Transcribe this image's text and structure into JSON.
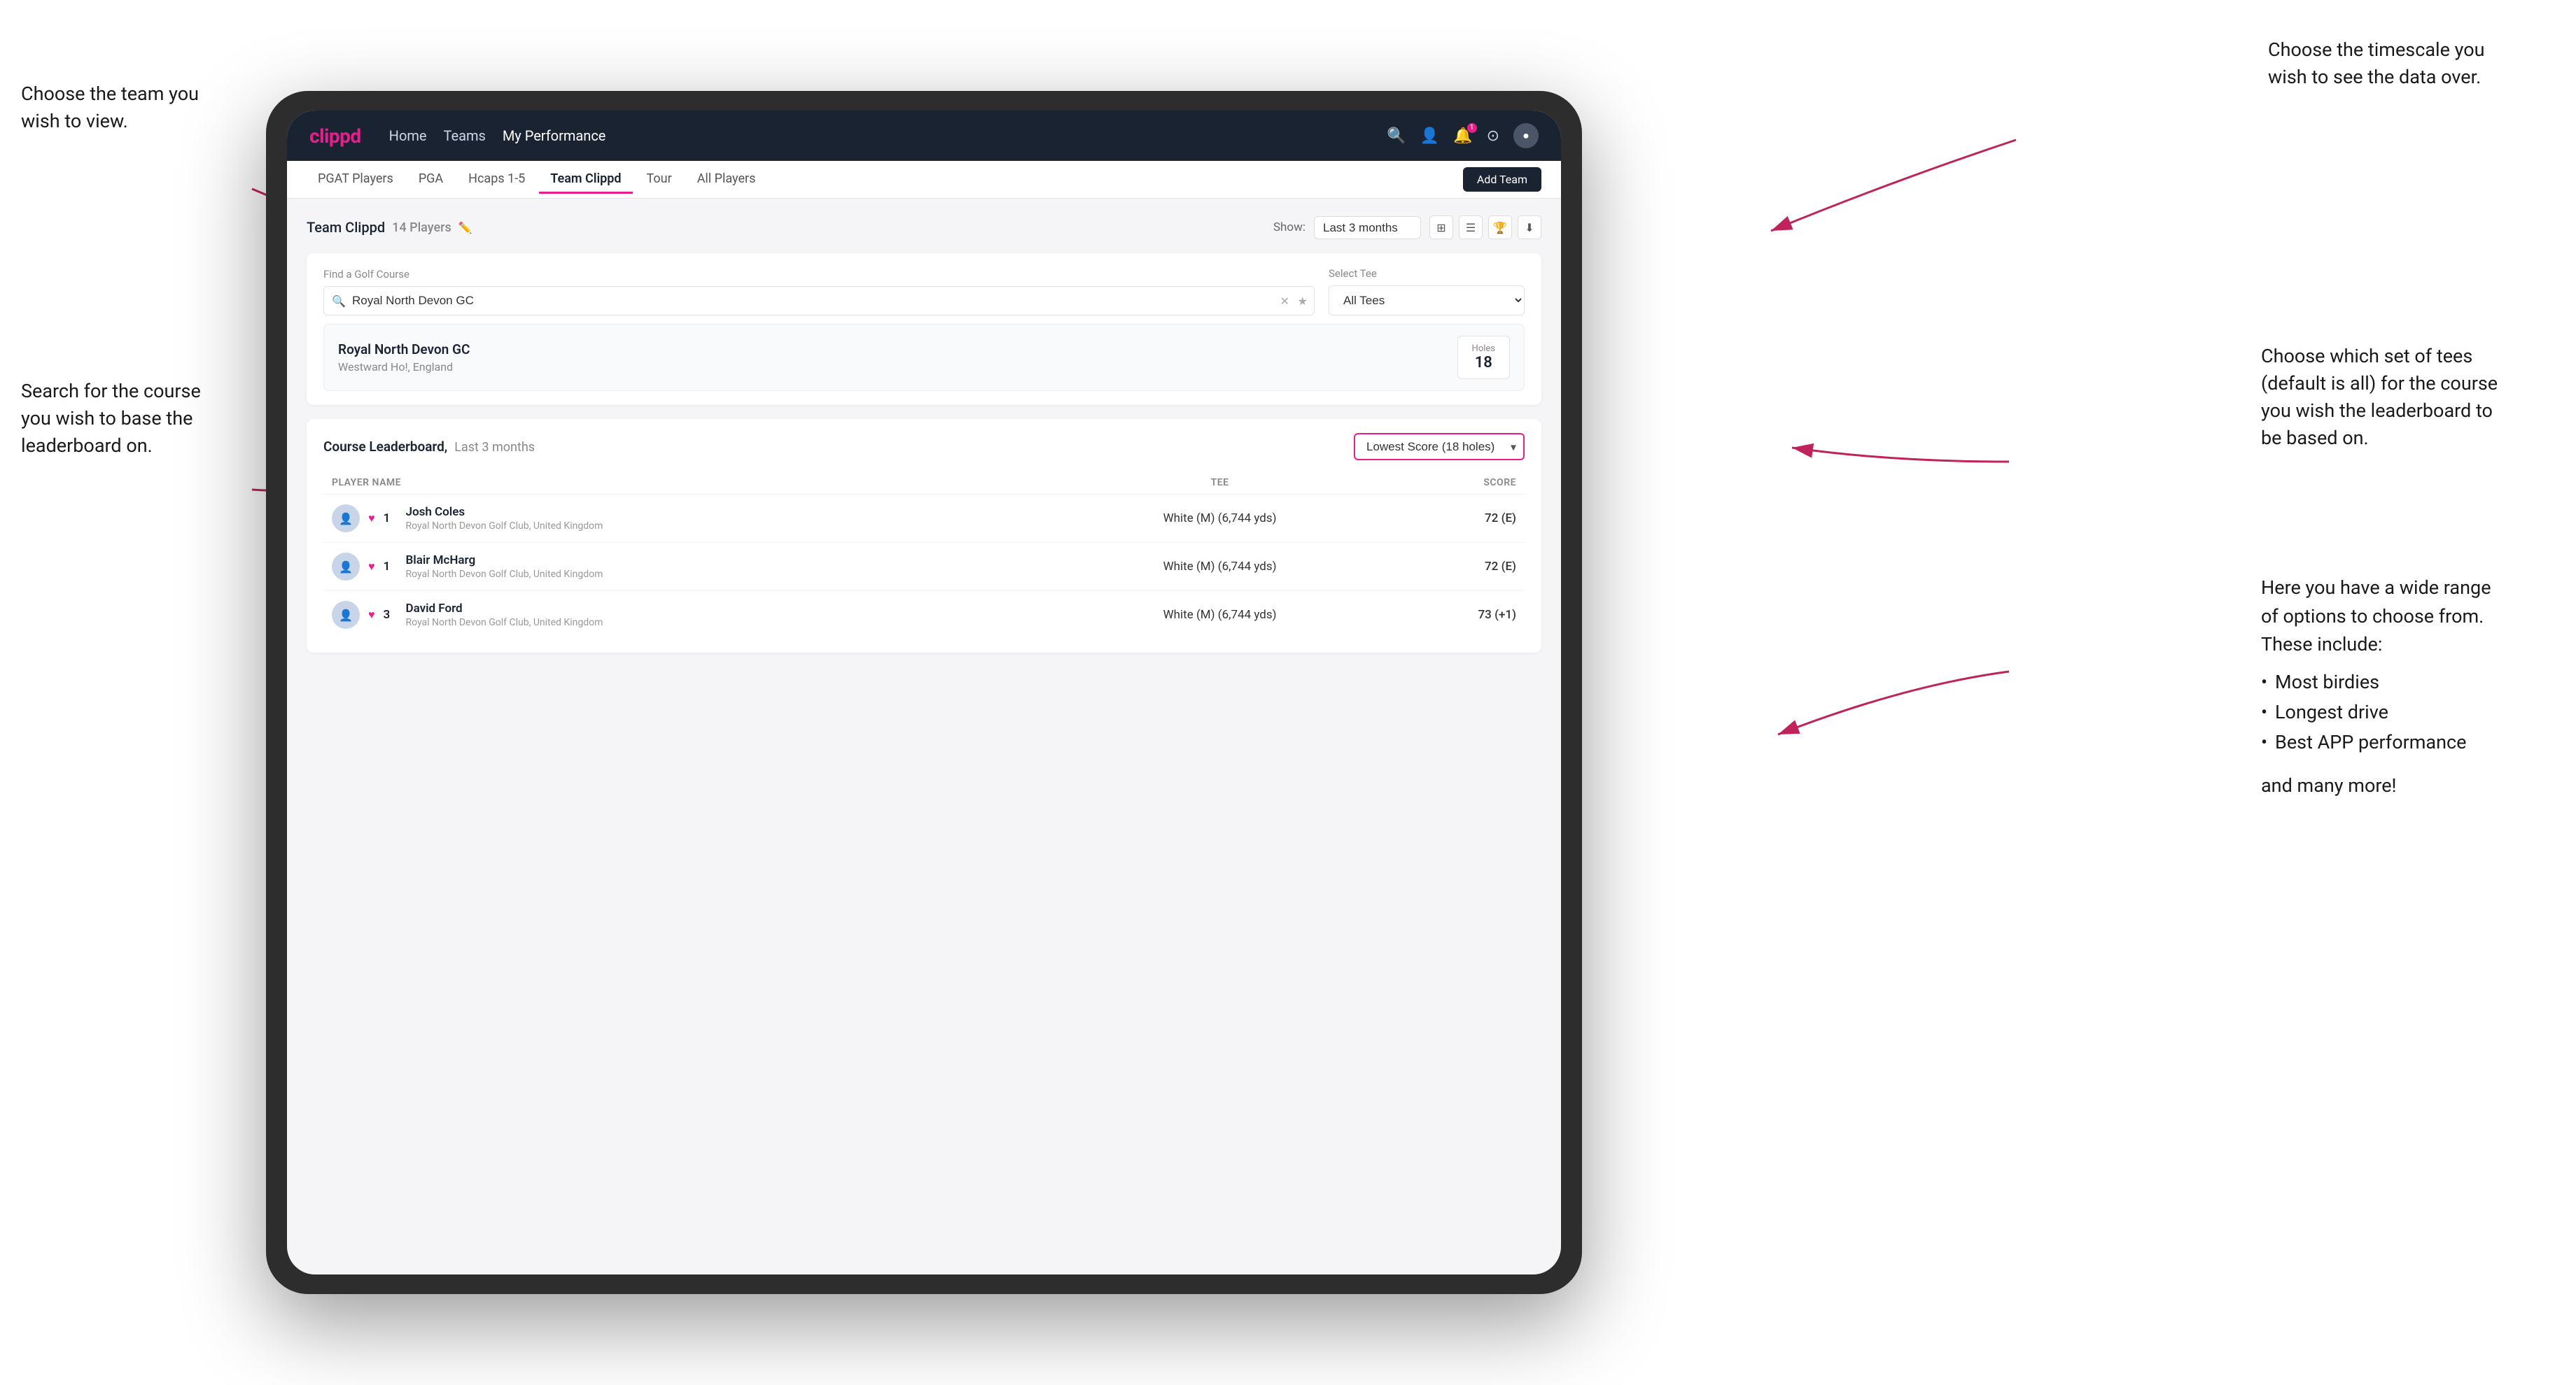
{
  "annotations": {
    "left_team": "Choose the team you\nwish to view.",
    "left_search": "Search for the course\nyou wish to base the\nleaderboard on.",
    "right_timescale": "Choose the timescale you\nwish to see the data over.",
    "right_tee": "Choose which set of tees\n(default is all) for the course\nyou wish the leaderboard to\nbe based on.",
    "right_options_title": "Here you have a wide range\nof options to choose from.\nThese include:",
    "right_options_bullets": [
      "Most birdies",
      "Longest drive",
      "Best APP performance"
    ],
    "right_options_more": "and many more!"
  },
  "navbar": {
    "logo": "clippd",
    "links": [
      {
        "label": "Home",
        "active": false
      },
      {
        "label": "Teams",
        "active": false
      },
      {
        "label": "My Performance",
        "active": true
      }
    ],
    "icons": [
      "search",
      "person",
      "bell",
      "settings",
      "avatar"
    ]
  },
  "subnav": {
    "tabs": [
      {
        "label": "PGAT Players",
        "active": false
      },
      {
        "label": "PGA",
        "active": false
      },
      {
        "label": "Hcaps 1-5",
        "active": false
      },
      {
        "label": "Team Clippd",
        "active": true
      },
      {
        "label": "Tour",
        "active": false
      },
      {
        "label": "All Players",
        "active": false
      }
    ],
    "add_team_label": "Add Team"
  },
  "team_header": {
    "title": "Team Clippd",
    "player_count": "14 Players",
    "show_label": "Show:",
    "show_value": "Last 3 months"
  },
  "search_filter": {
    "course_label": "Find a Golf Course",
    "course_placeholder": "Royal North Devon GC",
    "tee_label": "Select Tee",
    "tee_value": "All Tees"
  },
  "course_result": {
    "name": "Royal North Devon GC",
    "location": "Westward Ho!, England",
    "holes_label": "Holes",
    "holes_value": "18"
  },
  "leaderboard": {
    "title": "Course Leaderboard,",
    "subtitle": "Last 3 months",
    "score_options_value": "Lowest Score (18 holes)",
    "columns": {
      "player": "PLAYER NAME",
      "tee": "TEE",
      "score": "SCORE"
    },
    "players": [
      {
        "rank": 1,
        "name": "Josh Coles",
        "club": "Royal North Devon Golf Club, United Kingdom",
        "tee": "White (M) (6,744 yds)",
        "score": "72 (E)"
      },
      {
        "rank": 1,
        "name": "Blair McHarg",
        "club": "Royal North Devon Golf Club, United Kingdom",
        "tee": "White (M) (6,744 yds)",
        "score": "72 (E)"
      },
      {
        "rank": 3,
        "name": "David Ford",
        "club": "Royal North Devon Golf Club, United Kingdom",
        "tee": "White (M) (6,744 yds)",
        "score": "73 (+1)"
      }
    ]
  }
}
